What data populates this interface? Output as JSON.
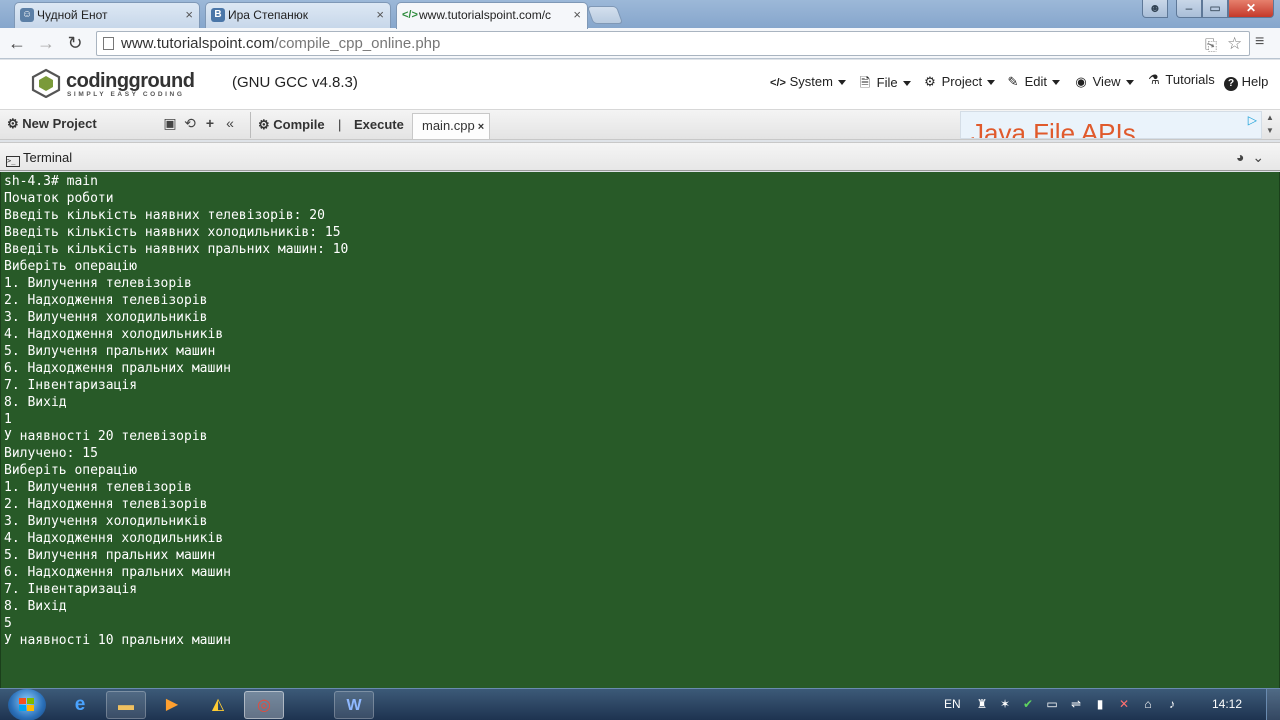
{
  "browser": {
    "tabs": [
      {
        "title": "Чудной Енот",
        "favicon": "vk-icon"
      },
      {
        "title": "Ира Степанюк",
        "favicon": "vk-icon"
      },
      {
        "title": "www.tutorialspoint.com/c",
        "favicon": "code-icon",
        "active": true
      }
    ],
    "tab_close": "×",
    "url_host": "www.tutorialspoint.com",
    "url_path": "/compile_cpp_online.php"
  },
  "header": {
    "logo_title": "codingground",
    "logo_sub": "SIMPLY EASY CODING",
    "compiler": "(GNU GCC v4.8.3)",
    "menu": {
      "system": "System",
      "file": "File",
      "project": "Project",
      "edit": "Edit",
      "view": "View",
      "tutorials": "Tutorials",
      "help": "Help"
    }
  },
  "projectbar": {
    "new_project": "New Project",
    "compile": "Compile",
    "separator": "|",
    "execute": "Execute",
    "file_tab": "main.cpp",
    "file_tab_close": "×",
    "ad_text": "Java File APIs"
  },
  "terminal": {
    "title": "Terminal",
    "lines": [
      "sh-4.3# main",
      "Початок роботи",
      "Введіть кількість наявних телевізорів: 20",
      "Введіть кількість наявних холодильників: 15",
      "Введіть кількість наявних пральних машин: 10",
      "Виберіть операцію",
      "1. Вилучення телевізорів",
      "2. Надходження телевізорів",
      "3. Вилучення холодильників",
      "4. Надходження холодильників",
      "5. Вилучення пральних машин",
      "6. Надходження пральних машин",
      "7. Інвентаризація",
      "8. Вихід",
      "1",
      "У наявності 20 телевізорів",
      "Вилучено: 15",
      "Виберіть операцію",
      "1. Вилучення телевізорів",
      "2. Надходження телевізорів",
      "3. Вилучення холодильників",
      "4. Надходження холодильників",
      "5. Вилучення пральних машин",
      "6. Надходження пральних машин",
      "7. Інвентаризація",
      "8. Вихід",
      "5",
      "У наявності 10 пральних машин"
    ]
  },
  "taskbar": {
    "language": "EN",
    "clock": "14:12"
  },
  "colors": {
    "terminal_bg": "#285a28",
    "terminal_text": "#ffffff",
    "taskbar": "#1e3350"
  }
}
